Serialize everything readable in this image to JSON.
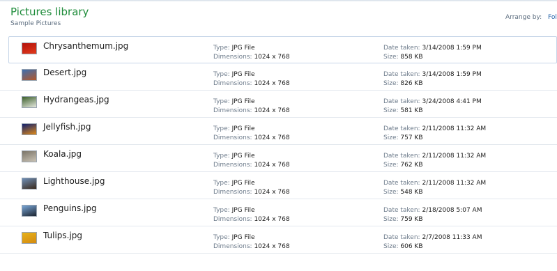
{
  "library": {
    "title": "Pictures library",
    "subtitle": "Sample Pictures",
    "arrange_label": "Arrange by:",
    "arrange_value": "Fol"
  },
  "labels": {
    "type": "Type:",
    "dimensions": "Dimensions:",
    "date_taken": "Date taken:",
    "size": "Size:"
  },
  "files": [
    {
      "name": "Chrysanthemum.jpg",
      "type": "JPG File",
      "dimensions": "1024 x 768",
      "date_taken": "3/14/2008 1:59 PM",
      "size": "858 KB",
      "thumb_colors": [
        "#b3120b",
        "#e23a1c"
      ]
    },
    {
      "name": "Desert.jpg",
      "type": "JPG File",
      "dimensions": "1024 x 768",
      "date_taken": "3/14/2008 1:59 PM",
      "size": "826 KB",
      "thumb_colors": [
        "#3d6fb0",
        "#b2572b"
      ]
    },
    {
      "name": "Hydrangeas.jpg",
      "type": "JPG File",
      "dimensions": "1024 x 768",
      "date_taken": "3/24/2008 4:41 PM",
      "size": "581 KB",
      "thumb_colors": [
        "#3b5f2a",
        "#e6e9e0"
      ]
    },
    {
      "name": "Jellyfish.jpg",
      "type": "JPG File",
      "dimensions": "1024 x 768",
      "date_taken": "2/11/2008 11:32 AM",
      "size": "757 KB",
      "thumb_colors": [
        "#0e1f6e",
        "#e08a1a"
      ]
    },
    {
      "name": "Koala.jpg",
      "type": "JPG File",
      "dimensions": "1024 x 768",
      "date_taken": "2/11/2008 11:32 AM",
      "size": "762 KB",
      "thumb_colors": [
        "#7a7468",
        "#c9c2b4"
      ]
    },
    {
      "name": "Lighthouse.jpg",
      "type": "JPG File",
      "dimensions": "1024 x 768",
      "date_taken": "2/11/2008 11:32 AM",
      "size": "548 KB",
      "thumb_colors": [
        "#6f8fb7",
        "#3a2a1c"
      ]
    },
    {
      "name": "Penguins.jpg",
      "type": "JPG File",
      "dimensions": "1024 x 768",
      "date_taken": "2/18/2008 5:07 AM",
      "size": "759 KB",
      "thumb_colors": [
        "#7aa7d8",
        "#1c2430"
      ]
    },
    {
      "name": "Tulips.jpg",
      "type": "JPG File",
      "dimensions": "1024 x 768",
      "date_taken": "2/7/2008 11:33 AM",
      "size": "606 KB",
      "thumb_colors": [
        "#e7b21a",
        "#d48a10"
      ]
    }
  ]
}
